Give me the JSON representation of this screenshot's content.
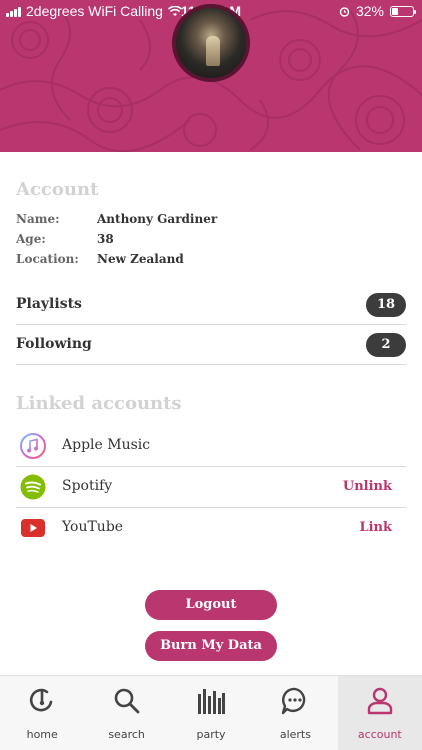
{
  "status_bar": {
    "carrier": "2degrees WiFi Calling",
    "time": "11:03 AM",
    "battery": "32%",
    "battery_level": 0.32
  },
  "account": {
    "title": "Account",
    "name_label": "Name:",
    "name_value": "Anthony Gardiner",
    "age_label": "Age:",
    "age_value": "38",
    "location_label": "Location:",
    "location_value": "New Zealand"
  },
  "stats": {
    "playlists_label": "Playlists",
    "playlists_count": "18",
    "following_label": "Following",
    "following_count": "2"
  },
  "linked": {
    "title": "Linked accounts",
    "items": [
      {
        "name": "Apple Music",
        "action": "",
        "icon": "apple-music-icon"
      },
      {
        "name": "Spotify",
        "action": "Unlink",
        "icon": "spotify-icon"
      },
      {
        "name": "YouTube",
        "action": "Link",
        "icon": "youtube-icon"
      }
    ]
  },
  "buttons": {
    "logout": "Logout",
    "burn": "Burn My Data"
  },
  "nav": {
    "items": [
      {
        "label": "home",
        "icon": "home-icon"
      },
      {
        "label": "search",
        "icon": "search-icon"
      },
      {
        "label": "party",
        "icon": "party-bars-icon"
      },
      {
        "label": "alerts",
        "icon": "chat-bubble-icon"
      },
      {
        "label": "account",
        "icon": "user-icon"
      }
    ],
    "active": "account"
  },
  "colors": {
    "accent": "#b9366f",
    "badge": "#3c3c3c"
  }
}
